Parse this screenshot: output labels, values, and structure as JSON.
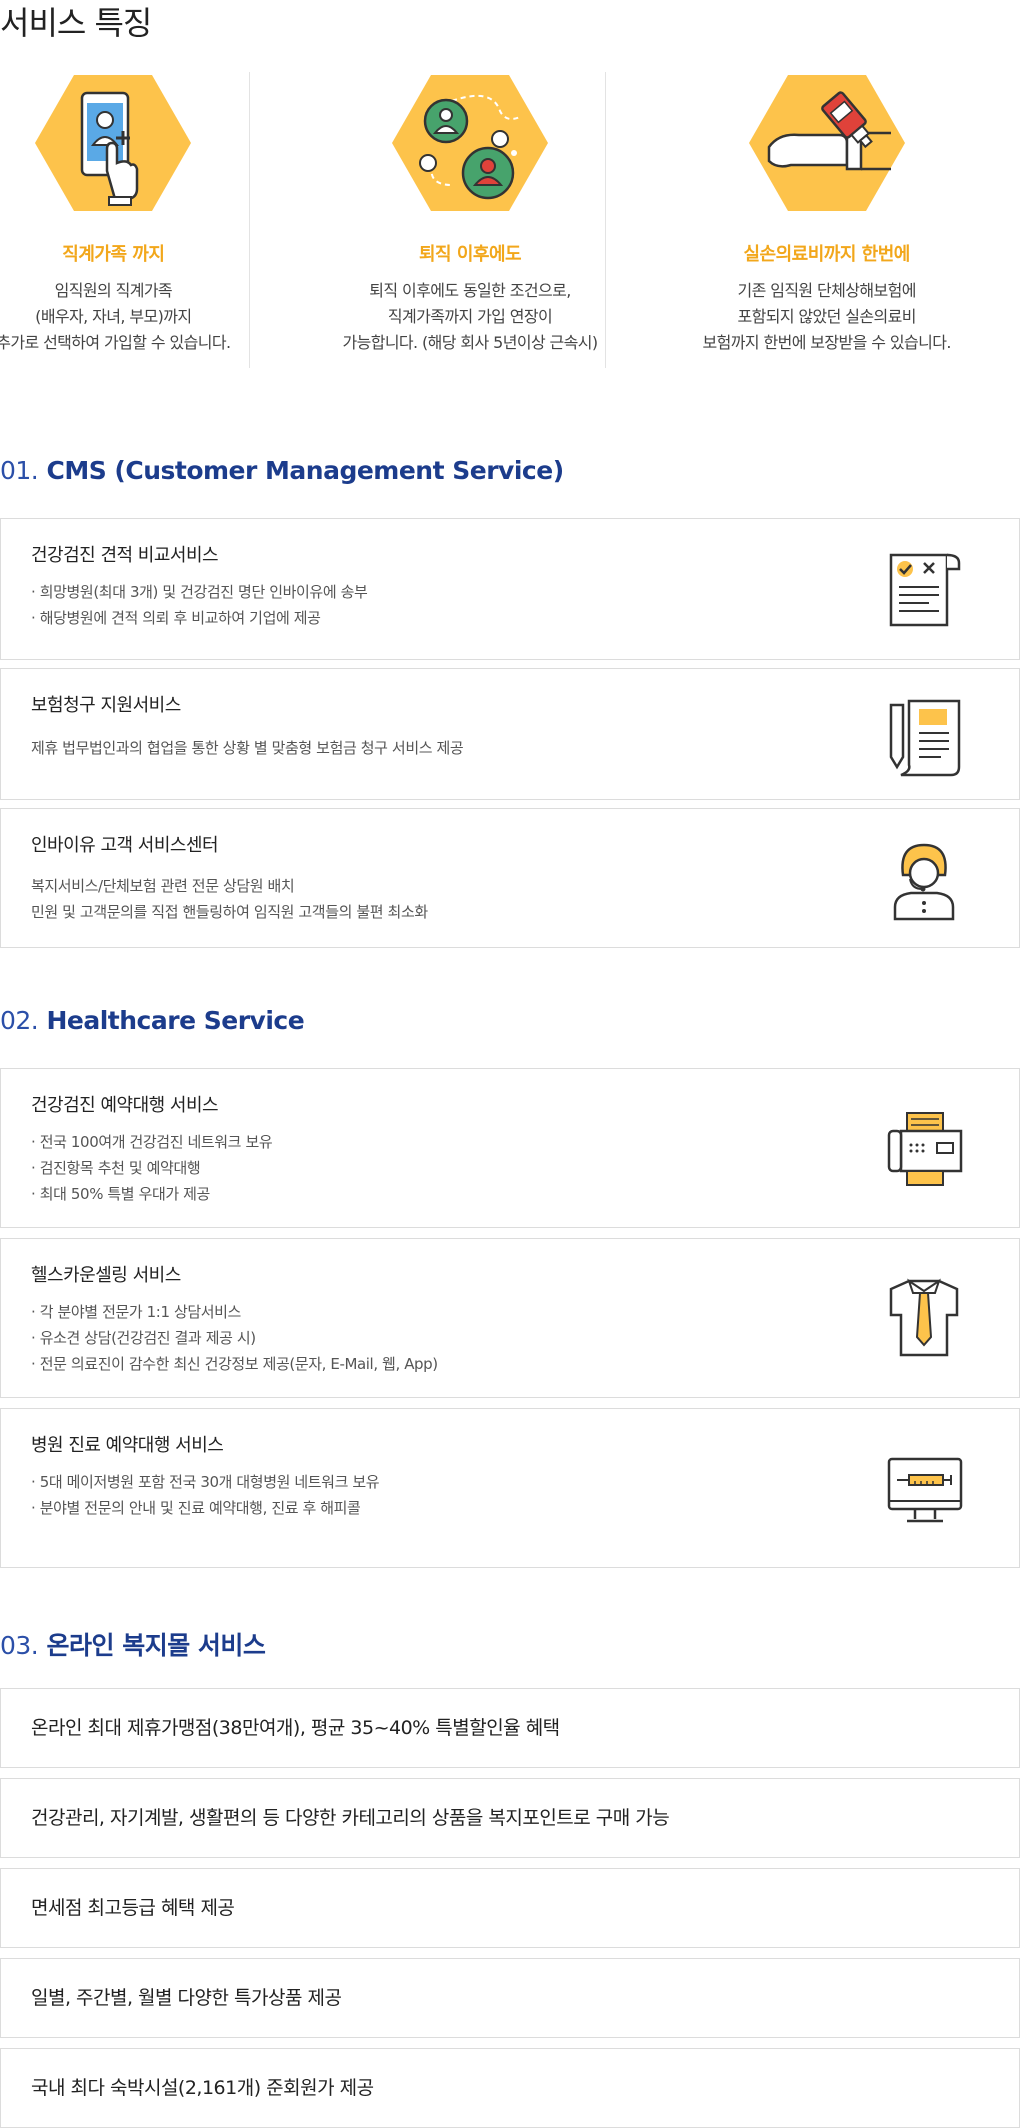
{
  "page_title": "서비스 특징",
  "features": [
    {
      "icon": "phone-add-person-icon",
      "title": "직계가족 까지",
      "lines": [
        "임직원의 직계가족",
        "(배우자, 자녀, 부모)까지",
        "추가로 선택하여 가입할 수 있습니다."
      ]
    },
    {
      "icon": "people-connect-icon",
      "title": "퇴직 이후에도",
      "lines": [
        "퇴직 이후에도 동일한 조건으로,",
        "직계가족까지 가입 연장이",
        "가능합니다. (해당 회사 5년이상 근속시)"
      ]
    },
    {
      "icon": "medicine-hand-icon",
      "title": "실손의료비까지 한번에",
      "lines": [
        "기존 임직원 단체상해보험에",
        "포함되지 않았던 실손의료비",
        "보험까지 한번에 보장받을 수 있습니다."
      ]
    }
  ],
  "sections": [
    {
      "num": "01.",
      "title": "CMS (Customer Management Service)",
      "cards": [
        {
          "title": "건강검진 견적 비교서비스",
          "lines": [
            "· 희망병원(최대 3개) 및 건강검진 명단 인바이유에 송부",
            "· 해당병원에 견적 의뢰 후 비교하여 기업에 제공"
          ],
          "icon": "checklist-document-icon"
        },
        {
          "title": "보험청구 지원서비스",
          "lines": [
            "제휴 법무법인과의 협업을 통한 상황 별 맞춤형 보험금 청구 서비스 제공"
          ],
          "icon": "scroll-pen-icon"
        },
        {
          "title": "인바이유 고객 서비스센터",
          "lines": [
            "복지서비스/단체보험 관련 전문 상담원 배치",
            "민원 및 고객문의를 직접 핸들링하여 임직원 고객들의 불편 최소화"
          ],
          "icon": "call-center-agent-icon"
        }
      ]
    },
    {
      "num": "02.",
      "title": "Healthcare Service",
      "cards": [
        {
          "title": "건강검진 예약대행 서비스",
          "lines": [
            "· 전국 100여개 건강검진 네트워크 보유",
            "· 검진항목 추천 및 예약대행",
            "· 최대 50% 특별 우대가 제공"
          ],
          "icon": "fax-machine-icon"
        },
        {
          "title": "헬스카운셀링 서비스",
          "lines": [
            "· 각 분야별 전문가 1:1 상담서비스",
            "· 유소견 상담(건강검진 결과 제공 시)",
            "· 전문 의료진이 감수한 최신 건강정보 제공(문자, E-Mail, 웹, App)"
          ],
          "icon": "shirt-tie-icon"
        },
        {
          "title": "병원 진료 예약대행 서비스",
          "lines": [
            "· 5대 메이저병원 포함 전국 30개 대형병원 네트워크 보유",
            "· 분야별 전문의 안내 및 진료 예약대행, 진료 후 해피콜"
          ],
          "icon": "monitor-syringe-icon"
        }
      ]
    },
    {
      "num": "03.",
      "title": "온라인 복지몰 서비스",
      "bars": [
        "온라인 최대 제휴가맹점(38만여개), 평균 35~40% 특별할인율 혜택",
        "건강관리, 자기계발, 생활편의 등 다양한 카테고리의 상품을 복지포인트로 구매 가능",
        "면세점 최고등급 혜택 제공",
        "일별, 주간별, 월별 다양한 특가상품 제공",
        "국내 최다 숙박시설(2,161개) 준회원가 제공"
      ]
    }
  ],
  "colors": {
    "accent": "#f2a71b",
    "hex_fill": "#fdc34b",
    "section_title": "#1c3c8c",
    "icon_line": "#333333"
  }
}
